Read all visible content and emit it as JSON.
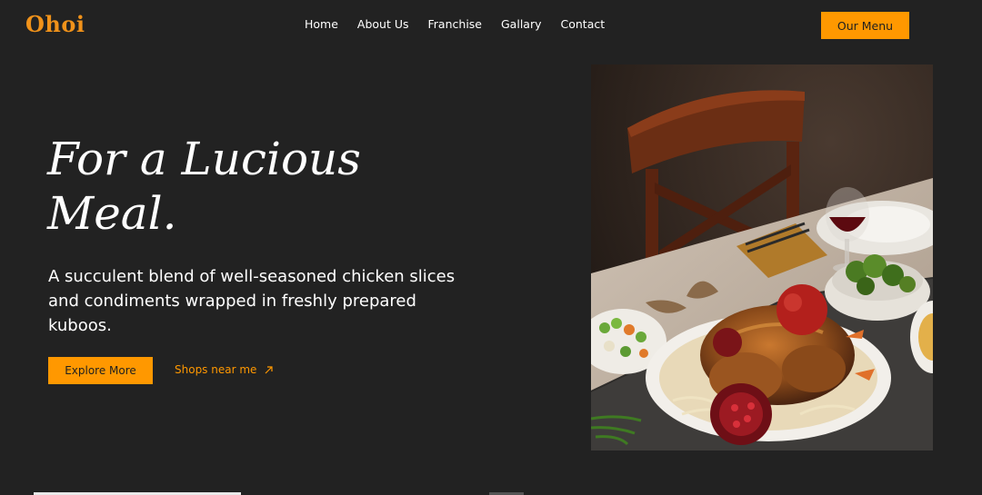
{
  "brand": {
    "logo_text": "Ohoi",
    "accent_color": "#ff9800",
    "background_color": "#222222"
  },
  "nav": {
    "items": [
      {
        "label": "Home"
      },
      {
        "label": "About Us"
      },
      {
        "label": "Franchise"
      },
      {
        "label": "Gallary"
      },
      {
        "label": "Contact"
      }
    ],
    "cta_label": "Our Menu"
  },
  "hero": {
    "headline_line1": "For a Lucious",
    "headline_line2": "Meal.",
    "description": "A succulent blend of well-seasoned chicken slices and condiments wrapped in freshly prepared kuboos.",
    "primary_button": "Explore More",
    "secondary_link": "Shops near me",
    "secondary_icon": "arrow-up-right-icon"
  },
  "image": {
    "subject": "roast-chicken-dinner-table"
  }
}
